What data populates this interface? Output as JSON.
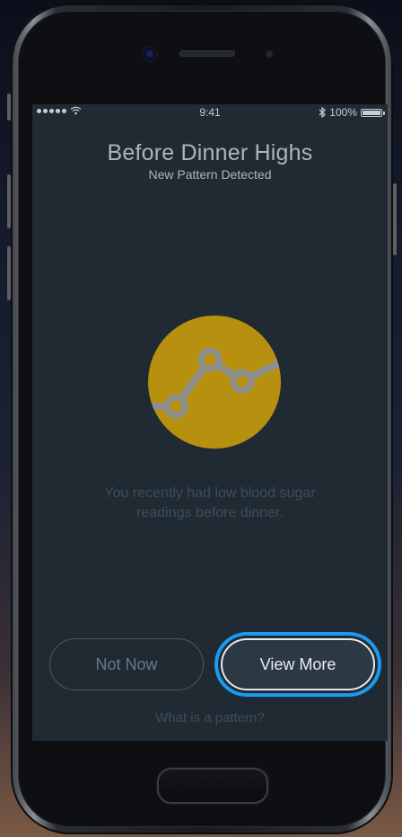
{
  "status_bar": {
    "time": "9:41",
    "battery_percent": "100%",
    "signal_bars": 5,
    "icons": [
      "wifi-icon",
      "bluetooth-icon",
      "battery-icon"
    ]
  },
  "screen": {
    "title": "Before Dinner Highs",
    "subtitle": "New Pattern Detected",
    "icon": "pattern-chart-icon",
    "message_line1": "You recently had low blood sugar",
    "message_line2": "readings before dinner.",
    "buttons": {
      "not_now": "Not Now",
      "view_more": "View More"
    },
    "help_link": "What is a pattern?"
  },
  "colors": {
    "accent_gold": "#b8900f",
    "focus_ring": "#1a9bf0",
    "screen_bg": "#1f2a33"
  }
}
